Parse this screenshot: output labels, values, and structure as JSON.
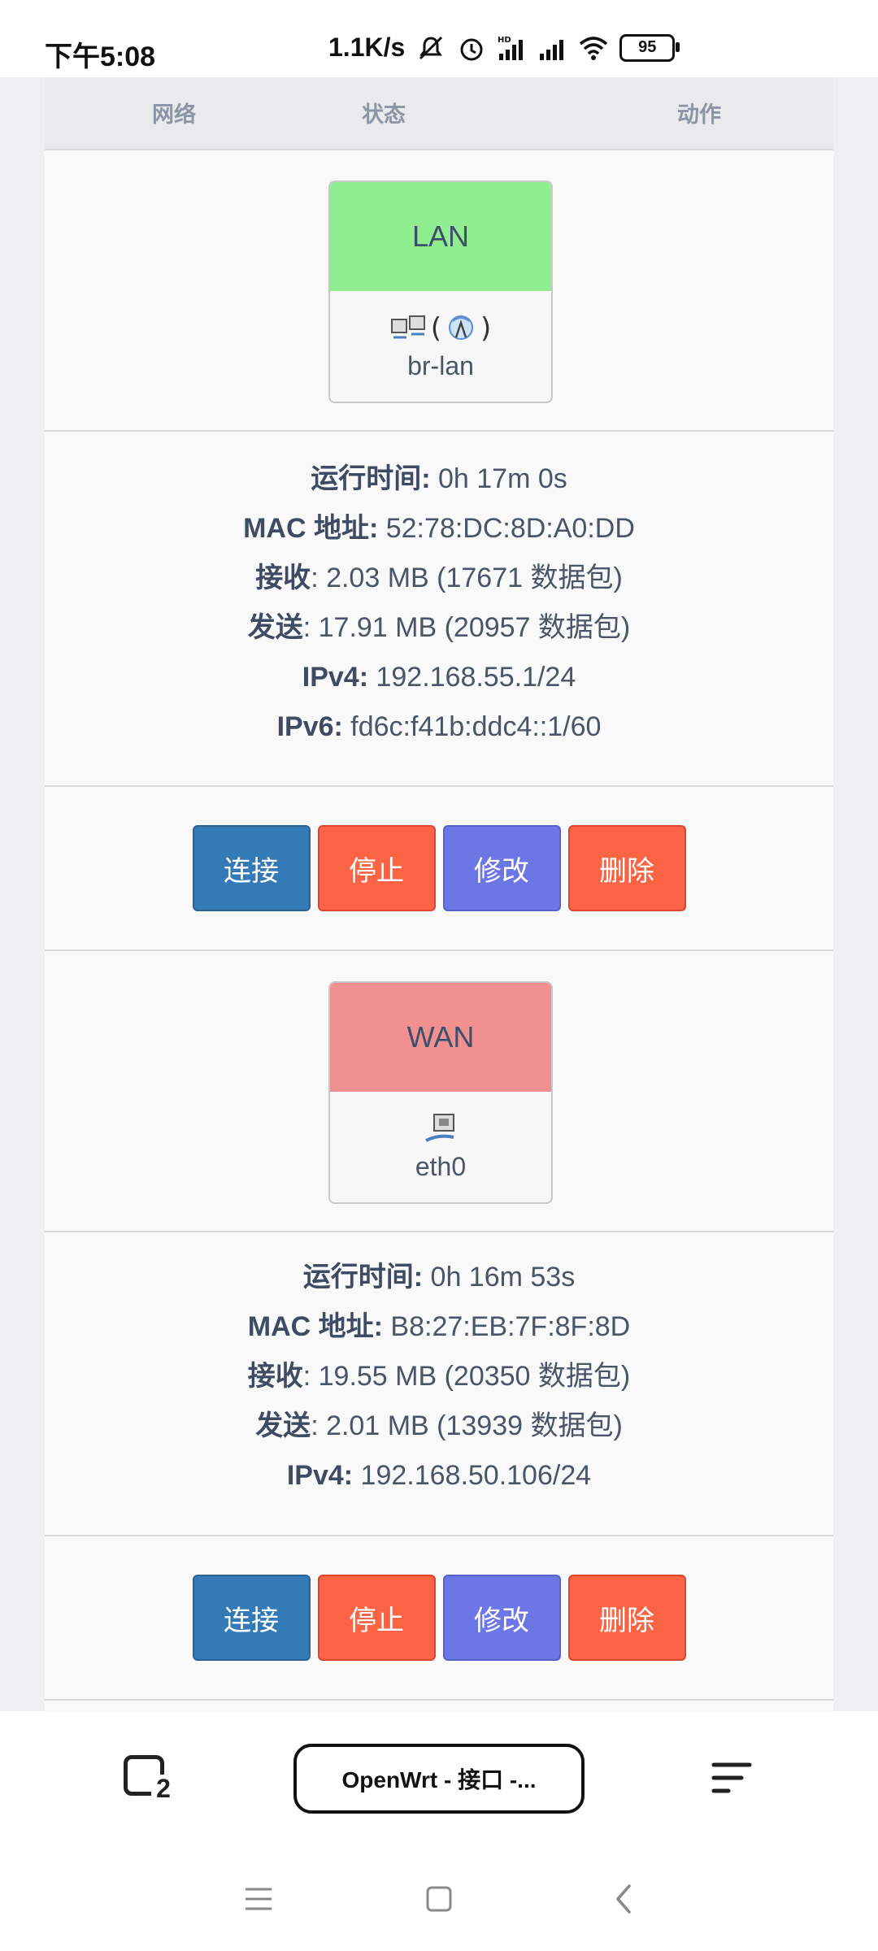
{
  "status_bar": {
    "time": "下午5:08",
    "speed": "1.1K/s",
    "battery": "95"
  },
  "table": {
    "headers": {
      "network": "网络",
      "status": "状态",
      "action": "动作"
    }
  },
  "interfaces": [
    {
      "name": "LAN",
      "header_color": "#90ee90",
      "device": "br-lan",
      "info": [
        {
          "k": "运行时间:",
          "v": " 0h 17m 0s"
        },
        {
          "k": "MAC 地址:",
          "v": " 52:78:DC:8D:A0:DD"
        },
        {
          "k": "接收",
          "v": ": 2.03 MB (17671 数据包)"
        },
        {
          "k": "发送",
          "v": ": 17.91 MB (20957 数据包)"
        },
        {
          "k": "IPv4:",
          "v": " 192.168.55.1/24"
        },
        {
          "k": "IPv6:",
          "v": " fd6c:f41b:ddc4::1/60"
        }
      ],
      "buttons": {
        "connect": "连接",
        "stop": "停止",
        "edit": "修改",
        "delete": "删除"
      }
    },
    {
      "name": "WAN",
      "header_color": "#f09090",
      "device": "eth0",
      "info": [
        {
          "k": "运行时间:",
          "v": " 0h 16m 53s"
        },
        {
          "k": "MAC 地址:",
          "v": " B8:27:EB:7F:8F:8D"
        },
        {
          "k": "接收",
          "v": ": 19.55 MB (20350 数据包)"
        },
        {
          "k": "发送",
          "v": ": 2.01 MB (13939 数据包)"
        },
        {
          "k": "IPv4:",
          "v": " 192.168.50.106/24"
        }
      ],
      "buttons": {
        "connect": "连接",
        "stop": "停止",
        "edit": "修改",
        "delete": "删除"
      }
    }
  ],
  "browser": {
    "tab_count": "2",
    "url_title": "OpenWrt - 接口 -..."
  }
}
